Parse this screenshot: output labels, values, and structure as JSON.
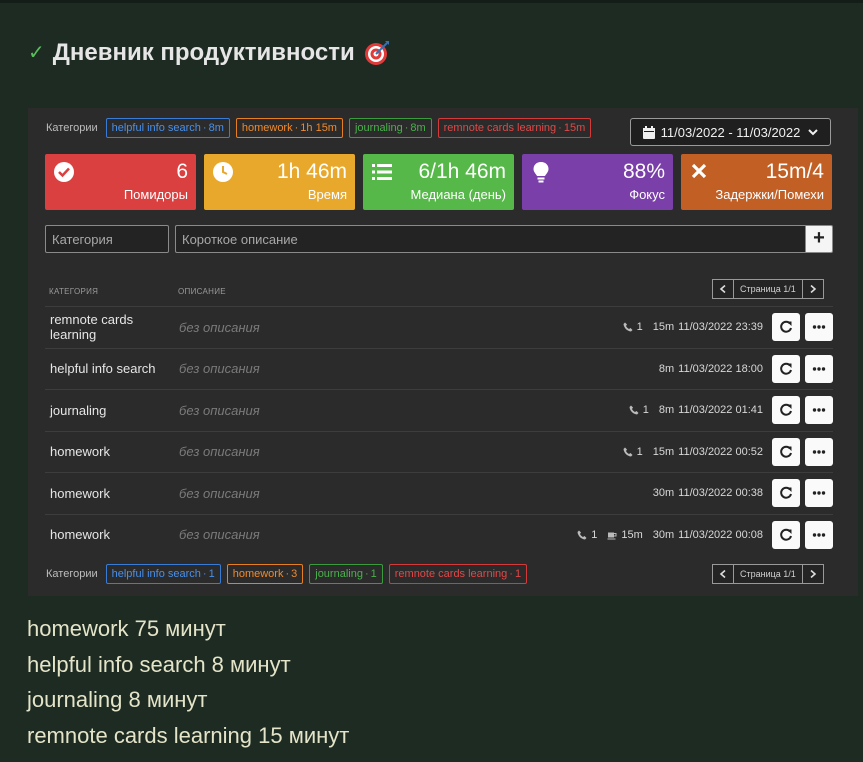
{
  "page": {
    "title": "Дневник продуктивности",
    "title_icon": "direct-hit-target-emoji",
    "check_icon": "checkmark-icon"
  },
  "filter_top": {
    "label": "Категории",
    "tags": [
      {
        "name": "helpful info search",
        "value": "8m",
        "color": "#4a8fe8"
      },
      {
        "name": "homework",
        "value": "1h 15m",
        "color": "#f08a2c"
      },
      {
        "name": "journaling",
        "value": "8m",
        "color": "#4bb04d"
      },
      {
        "name": "remnote cards learning",
        "value": "15m",
        "color": "#e04848"
      }
    ]
  },
  "date_range": "11/03/2022 - 11/03/2022",
  "stats": [
    {
      "value": "6",
      "label": "Помидоры",
      "icon": "check-circle-icon",
      "color": "#d9403f"
    },
    {
      "value": "1h 46m",
      "label": "Время",
      "icon": "clock-icon",
      "color": "#e8a82c"
    },
    {
      "value": "6/1h 46m",
      "label": "Медиана (день)",
      "icon": "list-icon",
      "color": "#56b849"
    },
    {
      "value": "88%",
      "label": "Фокус",
      "icon": "lightbulb-icon",
      "color": "#7a3fa8"
    },
    {
      "value": "15m/4",
      "label": "Задержки/Помехи",
      "icon": "close-icon",
      "color": "#c15f24"
    }
  ],
  "form": {
    "category_placeholder": "Категория",
    "description_placeholder": "Короткое описание",
    "add_label": "+"
  },
  "table": {
    "headers": {
      "category": "КАТЕГОРИЯ",
      "description": "ОПИСАНИЕ"
    },
    "pager_label": "Страница 1/1",
    "rows": [
      {
        "category": "remnote cards learning",
        "description": "без описания",
        "calls": "1",
        "breaks": "",
        "duration": "15m",
        "timestamp": "11/03/2022 23:39"
      },
      {
        "category": "helpful info search",
        "description": "без описания",
        "calls": "",
        "breaks": "",
        "duration": "8m",
        "timestamp": "11/03/2022 18:00"
      },
      {
        "category": "journaling",
        "description": "без описания",
        "calls": "1",
        "breaks": "",
        "duration": "8m",
        "timestamp": "11/03/2022 01:41"
      },
      {
        "category": "homework",
        "description": "без описания",
        "calls": "1",
        "breaks": "",
        "duration": "15m",
        "timestamp": "11/03/2022 00:52"
      },
      {
        "category": "homework",
        "description": "без описания",
        "calls": "",
        "breaks": "",
        "duration": "30m",
        "timestamp": "11/03/2022 00:38"
      },
      {
        "category": "homework",
        "description": "без описания",
        "calls": "1",
        "breaks": "15m",
        "duration": "30m",
        "timestamp": "11/03/2022 00:08"
      }
    ]
  },
  "filter_bottom": {
    "label": "Категории",
    "tags": [
      {
        "name": "helpful info search",
        "value": "1",
        "color": "#4a8fe8"
      },
      {
        "name": "homework",
        "value": "3",
        "color": "#f08a2c"
      },
      {
        "name": "journaling",
        "value": "1",
        "color": "#4bb04d"
      },
      {
        "name": "remnote cards learning",
        "value": "1",
        "color": "#e04848"
      }
    ]
  },
  "summary": [
    "homework 75 минут",
    "helpful info search 8 минут",
    "journaling 8 минут",
    "remnote cards learning 15 минут"
  ]
}
